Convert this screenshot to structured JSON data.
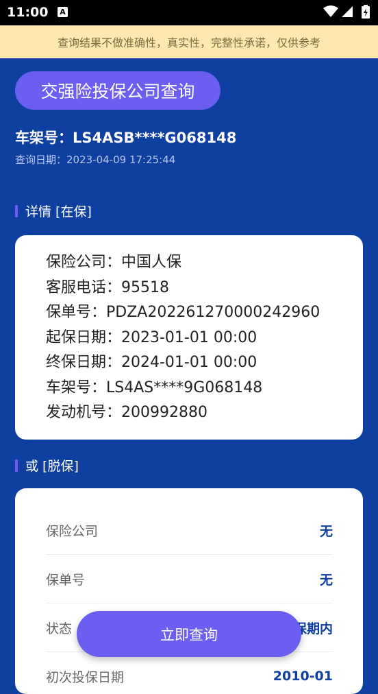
{
  "status_bar": {
    "time": "11:00",
    "notification_glyph": "A"
  },
  "notice": {
    "text": "查询结果不做准确性，真实性，完整性承诺，仅供参考"
  },
  "header": {
    "title": "交强险投保公司查询",
    "vin_line": "车架号：LS4ASB****G068148",
    "query_date_line": "查询日期：2023-04-09 17:25:44"
  },
  "section_insured": {
    "heading": "详情 [在保]"
  },
  "insured_details": [
    "保险公司：中国人保",
    "客服电话：95518",
    "保单号：PDZA202261270000242960",
    "起保日期：2023-01-01 00:00",
    "终保日期：2024-01-01 00:00",
    "车架号：LS4AS****9G068148",
    "发动机号：200992880"
  ],
  "section_lapsed": {
    "heading": "或 [脱保]"
  },
  "lapsed_details": [
    {
      "key": "保险公司",
      "value": "无"
    },
    {
      "key": "保单号",
      "value": "无"
    },
    {
      "key": "状态",
      "value": "保期内"
    },
    {
      "key": "初次投保日期",
      "value": "2010-01"
    }
  ],
  "cta": {
    "label": "立即查询"
  },
  "colors": {
    "primary": "#0f3fa0",
    "accent": "#6b5ef0",
    "notice_bg": "#fde8b0"
  }
}
